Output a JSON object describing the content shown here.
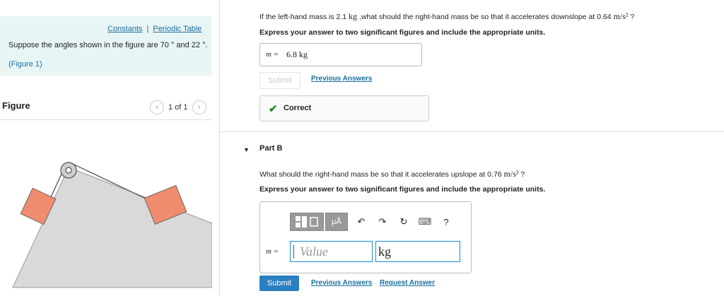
{
  "left": {
    "links": {
      "constants": "Constants",
      "separator": "|",
      "periodic_table": "Periodic Table"
    },
    "problem_text": "Suppose the angles shown in the figure are 70 ° and 22 °.",
    "figure_link": "(Figure 1)",
    "figure_label": "Figure",
    "pager": {
      "text": "1 of 1",
      "prev_icon": "‹",
      "next_icon": "›"
    }
  },
  "part_a": {
    "question_prefix": "If the left-hand mass is 2.1",
    "question_unit": "kg",
    "question_mid": ",what should the right-hand mass be so that it accelerates downslope at 0.64",
    "question_accel_unit": "m/s²",
    "question_end": "?",
    "instruction": "Express your answer to two significant figures and include the appropriate units.",
    "answer_var": "m =",
    "answer_value": "6.8 kg",
    "submit_label": "Submit",
    "previous_answers": "Previous Answers",
    "correct_label": "Correct",
    "check_icon": "✔"
  },
  "part_b": {
    "title": "Part B",
    "collapse_icon": "▼",
    "question_prefix": "What should the right-hand mass be so that it accelerates upslope at 0.76",
    "question_accel_unit": "m/s²",
    "question_end": "?",
    "instruction": "Express your answer to two significant figures and include the appropriate units.",
    "toolbar": {
      "templates_icon": "templates-icon",
      "units_label": "μÅ",
      "undo_icon": "↶",
      "redo_icon": "↷",
      "reset_icon": "↻",
      "keyboard_icon": "⌨",
      "help_icon": "?"
    },
    "answer_var": "m =",
    "value_placeholder": "Value",
    "unit_value": "kg",
    "submit_label": "Submit",
    "previous_answers": "Previous Answers",
    "request_answer": "Request Answer"
  },
  "colors": {
    "accent": "#2a7fc0",
    "link": "#1a6fa0",
    "info_bg": "#e8f5f5",
    "block": "#f08c6e",
    "incline": "#d9d9d9",
    "correct": "#2a8a2a"
  }
}
